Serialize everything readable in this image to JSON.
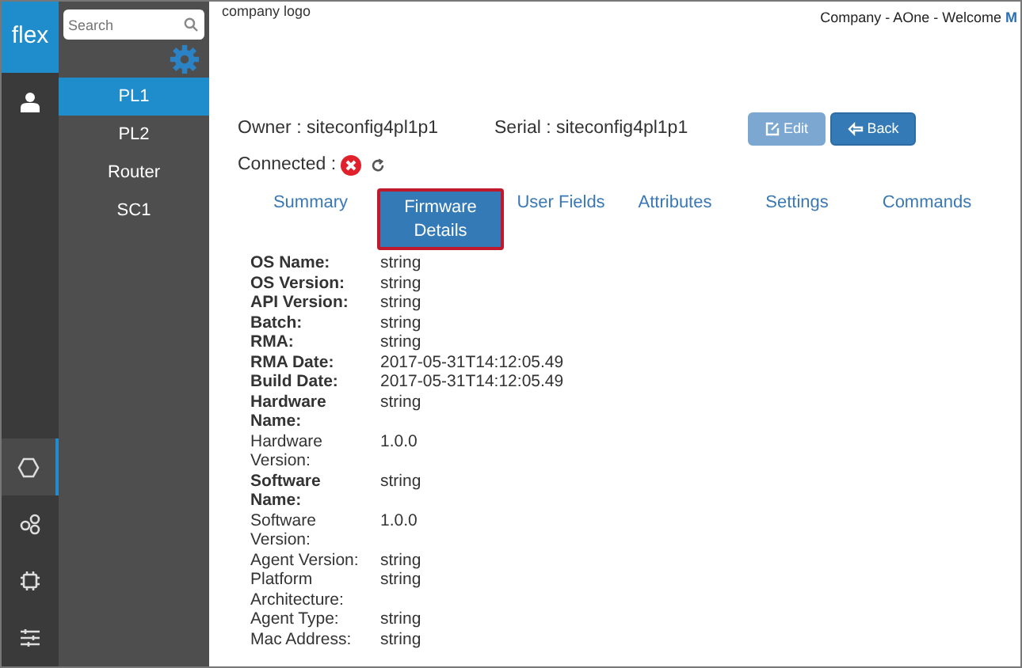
{
  "app": {
    "logo": "flex"
  },
  "rail": [
    {
      "kind": "user",
      "selected": false
    },
    {
      "kind": "hexagon",
      "selected": true
    },
    {
      "kind": "circles",
      "selected": false
    },
    {
      "kind": "chip",
      "selected": false
    },
    {
      "kind": "sliders",
      "selected": false
    }
  ],
  "sidebar": {
    "search": {
      "placeholder": "Search"
    },
    "items": [
      {
        "label": "PL1",
        "selected": true
      },
      {
        "label": "PL2",
        "selected": false
      },
      {
        "label": "Router",
        "selected": false
      },
      {
        "label": "SC1",
        "selected": false
      }
    ]
  },
  "header": {
    "logo_text": "company logo",
    "welcome": "Company - AOne - Welcome ",
    "user": "M"
  },
  "device": {
    "owner": "Owner : siteconfig4pl1p1",
    "serial": "Serial : siteconfig4pl1p1",
    "connected_label": "Connected :",
    "connected": false
  },
  "buttons": [
    {
      "kind": "edit",
      "label": "Edit",
      "disabled": true
    },
    {
      "kind": "back",
      "label": "Back",
      "disabled": false
    }
  ],
  "tabs": [
    {
      "label": "Summary",
      "selected": false
    },
    {
      "label": "Firmware Details",
      "selected": true
    },
    {
      "label": "User Fields",
      "selected": false
    },
    {
      "label": "Attributes",
      "selected": false
    },
    {
      "label": "Settings",
      "selected": false
    },
    {
      "label": "Commands",
      "selected": false
    }
  ],
  "details": [
    {
      "label": "OS Name:",
      "value": "string",
      "bold": true
    },
    {
      "label": "OS Version:",
      "value": "string",
      "bold": true
    },
    {
      "label": "API Version:",
      "value": "string",
      "bold": true
    },
    {
      "label": "Batch:",
      "value": "string",
      "bold": true
    },
    {
      "label": "RMA:",
      "value": "string",
      "bold": true
    },
    {
      "label": "RMA Date:",
      "value": "2017-05-31T14:12:05.49",
      "bold": true
    },
    {
      "label": "Build Date:",
      "value": "2017-05-31T14:12:05.49",
      "bold": true
    },
    {
      "label": "Hardware Name:",
      "value": "string",
      "bold": true
    },
    {
      "label": "Hardware Version:",
      "value": "1.0.0",
      "bold": false
    },
    {
      "label": "Software Name:",
      "value": "string",
      "bold": true
    },
    {
      "label": "Software Version:",
      "value": "1.0.0",
      "bold": false
    },
    {
      "label": "Agent Version:",
      "value": "string",
      "bold": false
    },
    {
      "label": "Platform Architecture:",
      "value": "string",
      "bold": false
    },
    {
      "label": "Agent Type:",
      "value": "string",
      "bold": false
    },
    {
      "label": "Mac Address:",
      "value": "string",
      "bold": false
    }
  ]
}
